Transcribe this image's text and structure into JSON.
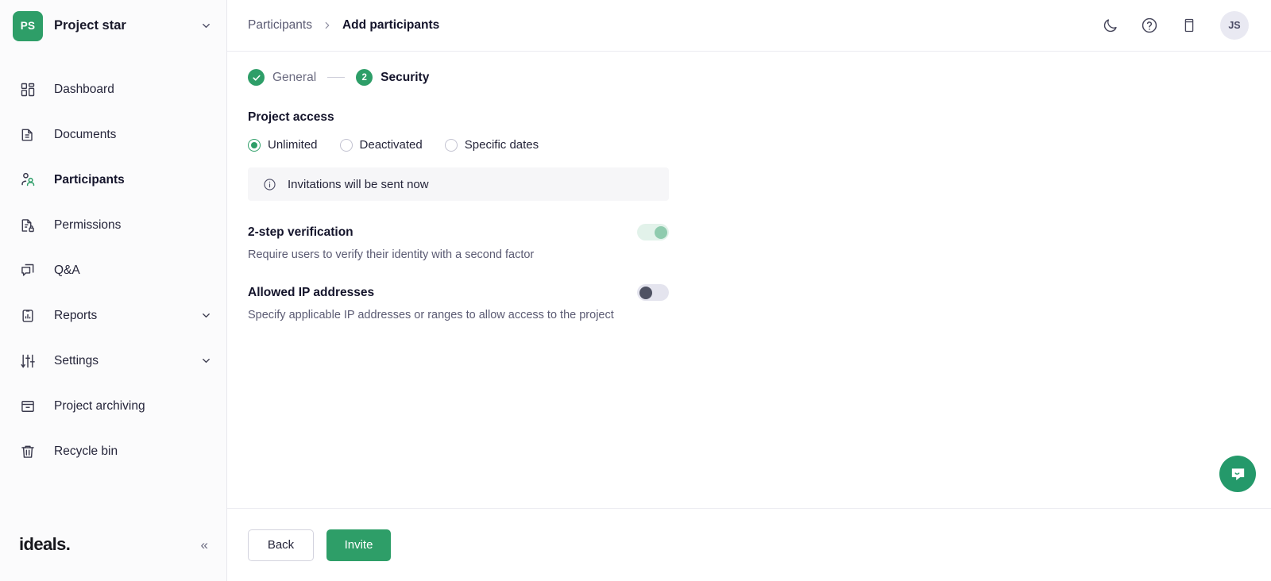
{
  "sidebar": {
    "project": {
      "badge": "PS",
      "name": "Project star",
      "chevron_icon": "chevron-down-icon"
    },
    "items": [
      {
        "label": "Dashboard",
        "icon": "dashboard-grid-icon",
        "active": false,
        "expandable": false
      },
      {
        "label": "Documents",
        "icon": "document-icon",
        "active": false,
        "expandable": false
      },
      {
        "label": "Participants",
        "icon": "participants-icon",
        "active": true,
        "expandable": false
      },
      {
        "label": "Permissions",
        "icon": "document-lock-icon",
        "active": false,
        "expandable": false
      },
      {
        "label": "Q&A",
        "icon": "chat-copy-icon",
        "active": false,
        "expandable": false
      },
      {
        "label": "Reports",
        "icon": "report-chart-icon",
        "active": false,
        "expandable": true
      },
      {
        "label": "Settings",
        "icon": "sliders-icon",
        "active": false,
        "expandable": true
      },
      {
        "label": "Project archiving",
        "icon": "archive-box-icon",
        "active": false,
        "expandable": false
      },
      {
        "label": "Recycle bin",
        "icon": "trash-icon",
        "active": false,
        "expandable": false
      }
    ],
    "brand": "ideals.",
    "collapse_label": "«"
  },
  "topbar": {
    "breadcrumb": {
      "parent": "Participants",
      "separator": "›",
      "current": "Add participants"
    },
    "actions": [
      {
        "name": "dark-mode-icon"
      },
      {
        "name": "help-circle-icon"
      },
      {
        "name": "mobile-device-icon"
      }
    ],
    "avatar_initials": "JS"
  },
  "stepper": {
    "steps": [
      {
        "label": "General",
        "number": "1",
        "state": "completed",
        "check": "✓"
      },
      {
        "label": "Security",
        "number": "2",
        "state": "current"
      }
    ]
  },
  "form": {
    "project_access": {
      "title": "Project access",
      "options": [
        {
          "label": "Unlimited",
          "selected": true
        },
        {
          "label": "Deactivated",
          "selected": false
        },
        {
          "label": "Specific dates",
          "selected": false
        }
      ]
    },
    "info_banner": {
      "icon": "info-circle-icon",
      "text": "Invitations will be sent now"
    },
    "toggles": [
      {
        "title": "2-step verification",
        "description": "Require users to verify their identity with a second factor",
        "state": "on"
      },
      {
        "title": "Allowed IP addresses",
        "description": "Specify applicable IP addresses or ranges to allow access to the project",
        "state": "off"
      }
    ]
  },
  "footer": {
    "back_label": "Back",
    "invite_label": "Invite"
  },
  "chat": {
    "icon": "chat-bubble-icon"
  },
  "colors": {
    "brand_green": "#2e9e68",
    "chat_green": "#24996a",
    "toggle_on_track": "#e2f2ea",
    "toggle_on_knob": "#8fcbae",
    "toggle_off_track": "#e4e4ee",
    "toggle_off_knob": "#4f5263",
    "sidebar_bg": "#fbfbfc",
    "banner_bg": "#f6f6f8",
    "text_dark": "#14142b",
    "text_muted": "#5b5b73"
  }
}
